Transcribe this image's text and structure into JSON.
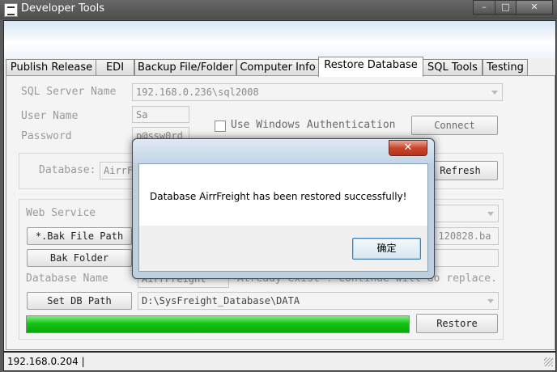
{
  "window": {
    "title": "Developer Tools",
    "controls": {
      "minimize": "–",
      "maximize": "□",
      "close": "✕"
    }
  },
  "tabs": [
    {
      "label": "Publish Release",
      "active": false
    },
    {
      "label": "EDI",
      "active": false
    },
    {
      "label": "Backup File/Folder",
      "active": false
    },
    {
      "label": "Computer Info",
      "active": false
    },
    {
      "label": "Restore Database",
      "active": true
    },
    {
      "label": "SQL Tools",
      "active": false
    },
    {
      "label": "Testing",
      "active": false
    }
  ],
  "restore": {
    "sql_server_label": "SQL Server Name",
    "sql_server_value": "192.168.0.236\\sql2008",
    "user_name_label": "User Name",
    "user_name_value": "Sa",
    "password_label": "Password",
    "password_value": "p@ssw0rd",
    "use_windows_auth_label": "Use Windows Authentication",
    "use_windows_auth_checked": false,
    "connect_button": "Connect",
    "database_label": "Database:",
    "database_value": "AirrF",
    "refresh_button": "Refresh",
    "web_service_label": "Web Service",
    "bak_file_path_button": "*.Bak File Path",
    "bak_file_path_value": "k 120828.ba",
    "bak_folder_button": "Bak Folder",
    "database_name_label": "Database Name",
    "database_name_value": "AirrFreight",
    "already_exist_note": "Already exist ! Continue will do replace.",
    "set_db_path_button": "Set DB Path",
    "db_path_value": "D:\\SysFreight_Database\\DATA",
    "restore_button": "Restore",
    "progress_percent": 100
  },
  "status_bar": {
    "text": "192.168.0.204  |"
  },
  "dialog": {
    "close_glyph": "✕",
    "message": "Database AirrFreight has been restored successfully!",
    "ok_button": "确定"
  }
}
